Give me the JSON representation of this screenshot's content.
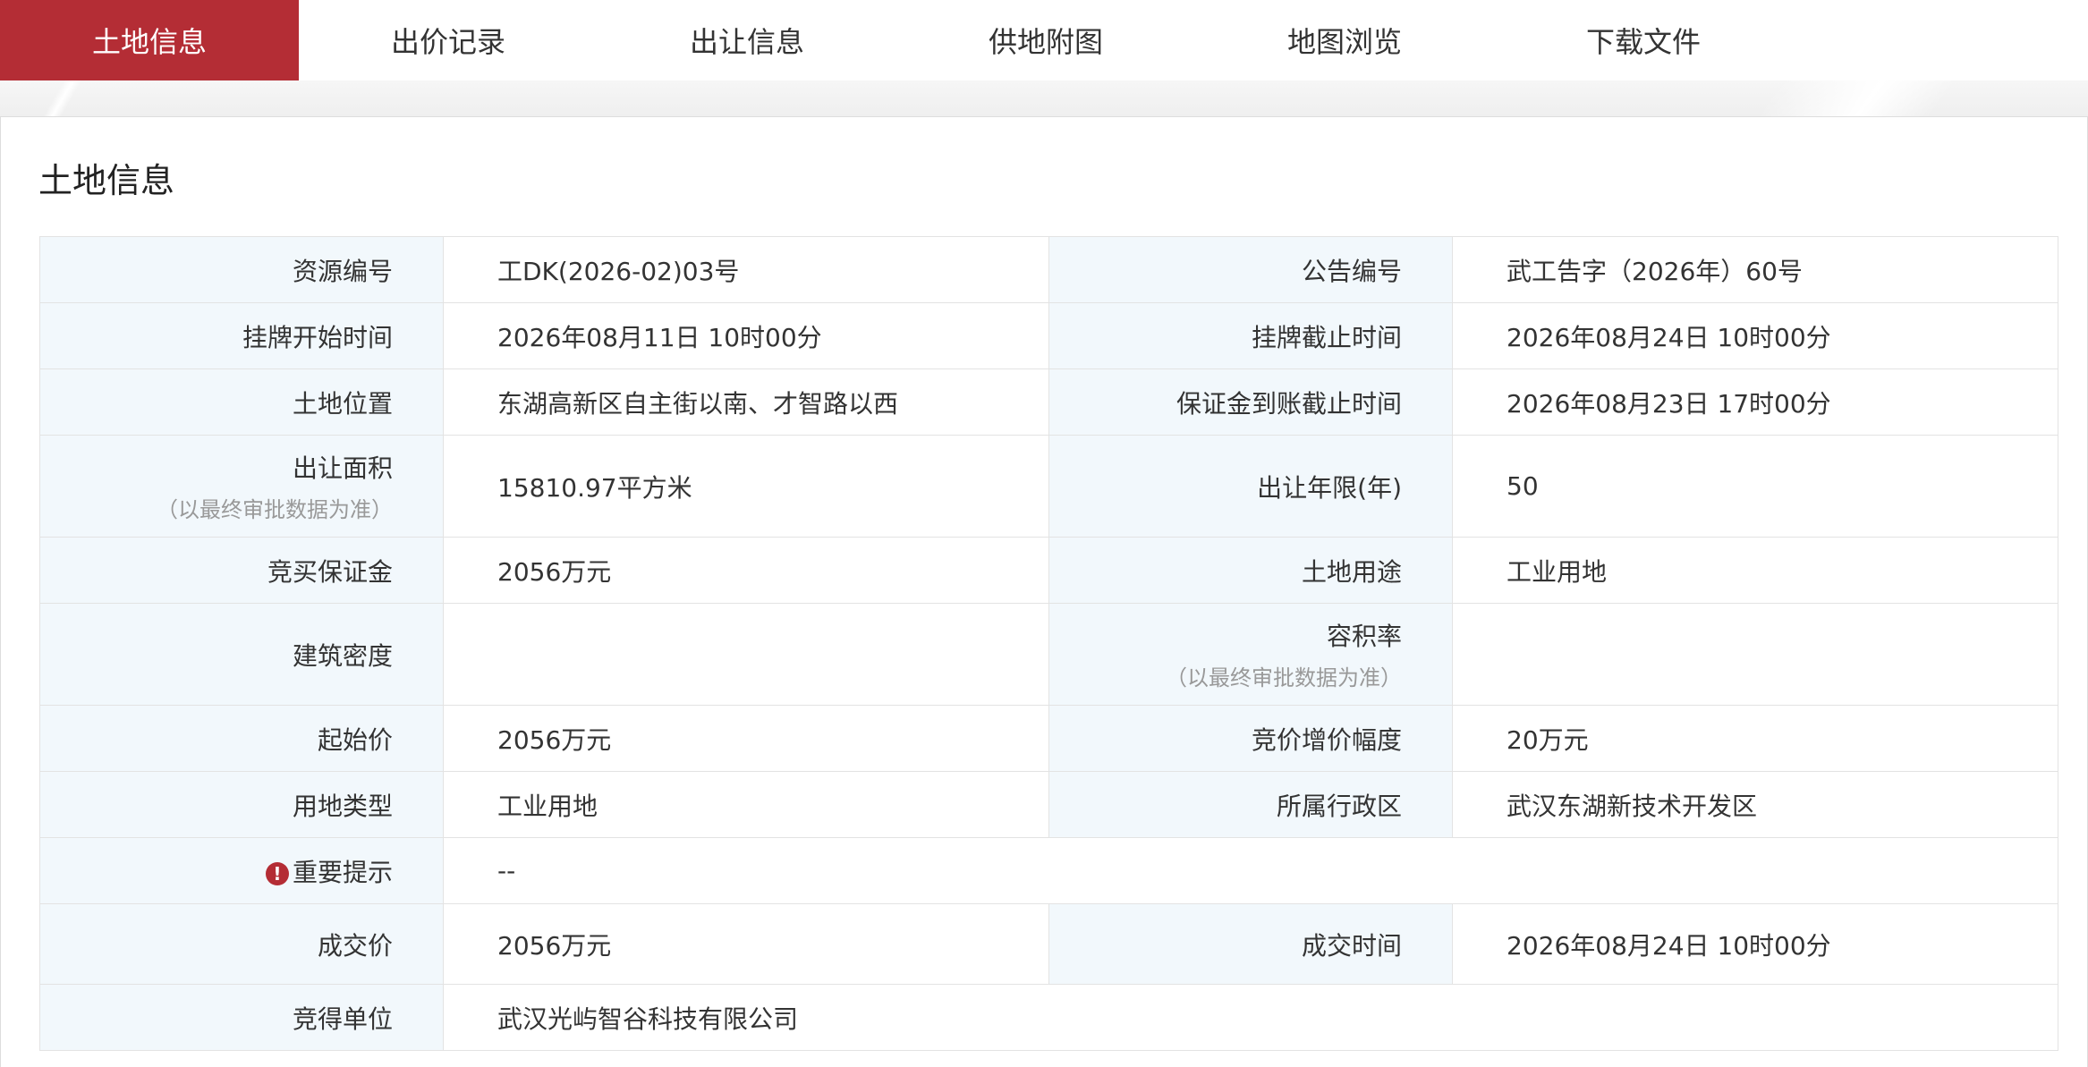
{
  "tabs": [
    "土地信息",
    "出价记录",
    "出让信息",
    "供地附图",
    "地图浏览",
    "下载文件"
  ],
  "section_title": "土地信息",
  "rows": {
    "r1": {
      "l1": "资源编号",
      "v1": "工DK(2026-02)03号",
      "l2": "公告编号",
      "v2": "武工告字（2026年）60号"
    },
    "r2": {
      "l1": "挂牌开始时间",
      "v1": "2026年08月11日 10时00分",
      "l2": "挂牌截止时间",
      "v2": "2026年08月24日 10时00分"
    },
    "r3": {
      "l1": "土地位置",
      "v1": "东湖高新区自主街以南、才智路以西",
      "l2": "保证金到账截止时间",
      "v2": "2026年08月23日 17时00分"
    },
    "r4": {
      "l1": "出让面积",
      "l1_sub": "（以最终审批数据为准）",
      "v1": "15810.97平方米",
      "l2": "出让年限(年)",
      "v2": "50"
    },
    "r5": {
      "l1": "竞买保证金",
      "v1": "2056万元",
      "l2": "土地用途",
      "v2": "工业用地"
    },
    "r6": {
      "l1": "建筑密度",
      "v1": "",
      "l2": "容积率",
      "l2_sub": "（以最终审批数据为准）",
      "v2": ""
    },
    "r7": {
      "l1": "起始价",
      "v1": "2056万元",
      "l2": "竞价增价幅度",
      "v2": "20万元"
    },
    "r8": {
      "l1": "用地类型",
      "v1": "工业用地",
      "l2": "所属行政区",
      "v2": "武汉东湖新技术开发区"
    },
    "r9": {
      "l1": "重要提示",
      "v1": "--"
    },
    "r10": {
      "l1": "成交价",
      "v1": "2056万元",
      "l2": "成交时间",
      "v2": "2026年08月24日 10时00分"
    },
    "r11": {
      "l1": "竞得单位",
      "v1": "武汉光屿智谷科技有限公司"
    }
  },
  "icons": {
    "important": "exclamation-circle-icon"
  },
  "colors": {
    "accent": "#b42d35",
    "label_bg": "#f2f8fc"
  }
}
